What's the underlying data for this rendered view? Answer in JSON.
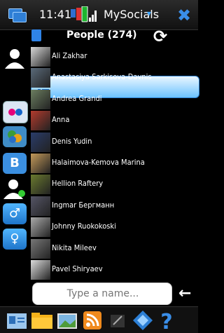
{
  "status": {
    "time": "11:41",
    "app_name": "MySocials",
    "caret": "▾",
    "close": "✖"
  },
  "header": {
    "title": "People (274)"
  },
  "people": [
    {
      "name": "Ali Zakhar",
      "color": "#d8d8d8"
    },
    {
      "name": "Anastasiya Sarkisova-Davnis",
      "color": "#5a6a7a"
    },
    {
      "name": "Andrea Grandi",
      "color": "#6b7e60"
    },
    {
      "name": "Anna",
      "color": "#b33b2d"
    },
    {
      "name": "Denis Yudin",
      "color": "#2a3c6a"
    },
    {
      "name": "Halaimova-Kemova Marina",
      "color": "#c49a5a"
    },
    {
      "name": "Hellion Raftery",
      "color": "#6a7a2f"
    },
    {
      "name": "Ingmar Бергманн",
      "color": "#556"
    },
    {
      "name": "Johnny Ruokokoski",
      "color": "#aaa"
    },
    {
      "name": "Nikita Mileev",
      "color": "#777"
    },
    {
      "name": "Pavel Shiryaev",
      "color": "#ddd"
    }
  ],
  "search": {
    "placeholder": "Type a name..."
  },
  "back": "←",
  "sidebar_labels": {
    "vk": "B",
    "male": "♂",
    "female": "♀"
  }
}
